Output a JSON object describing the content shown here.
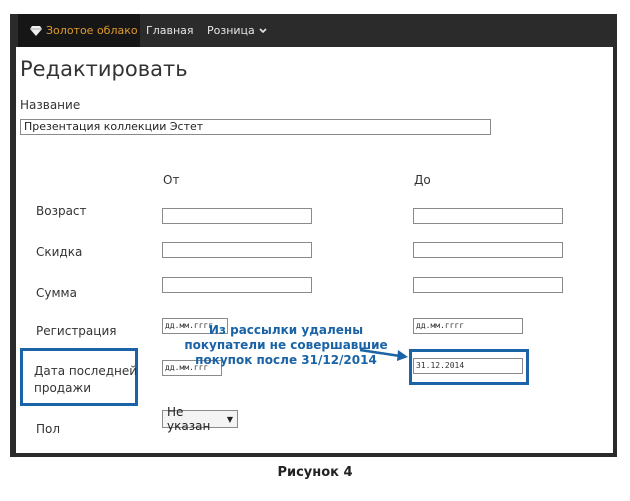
{
  "nav": {
    "brand_label": "Золотое облако",
    "home_label": "Главная",
    "retail_label": "Розница"
  },
  "page": {
    "title": "Редактировать",
    "name_label": "Название",
    "name_value": "Презентация коллекции Эстет",
    "col_from": "От",
    "col_to": "До"
  },
  "rows": {
    "age_label": "Возраст",
    "discount_label": "Скидка",
    "sum_label": "Сумма",
    "registration_label": "Регистрация",
    "registration_from_value": "дд.мм.гггг",
    "registration_to_value": "дд.мм.гггг",
    "last_sale_label_line1": "Дата последней",
    "last_sale_label_line2": "продажи",
    "last_sale_from_value": "дд.мм.ггг",
    "last_sale_to_value": "31.12.2014",
    "gender_label": "Пол",
    "gender_value": "Не указан"
  },
  "annotation": {
    "line1": "Из рассылки удалены",
    "line2": "покупатели не совершавшие",
    "line3": "покупок после 31/12/2014"
  },
  "caption": "Рисунок 4",
  "colors": {
    "navbar": "#2b2b2b",
    "brand": "#e09b2d",
    "highlight": "#1a63a6"
  }
}
